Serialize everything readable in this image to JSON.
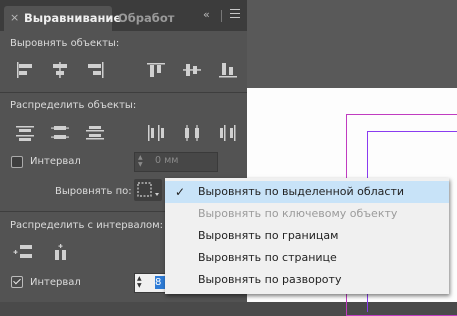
{
  "tabs": [
    {
      "label": "Выравнивание",
      "active": true
    },
    {
      "label": "Обработ",
      "active": false
    }
  ],
  "icons": {
    "tab_close": "×",
    "collapse": "‹‹"
  },
  "sections": {
    "align_objects": "Выровнять объекты:",
    "distribute_objects": "Распределить объекты:",
    "distribute_spacing": "Распределить с интервалом:"
  },
  "distribute_interval": {
    "label": "Интервал",
    "checked": false,
    "value": "0 мм"
  },
  "align_to": {
    "label": "Выровнять по:"
  },
  "spacing_interval": {
    "label": "Интервал",
    "checked": true,
    "value": "8"
  },
  "dropdown": {
    "options": [
      {
        "label": "Выровнять по выделенной области",
        "selected": true,
        "disabled": false
      },
      {
        "label": "Выровнять по ключевому объекту",
        "selected": false,
        "disabled": true
      },
      {
        "label": "Выровнять по границам",
        "selected": false,
        "disabled": false
      },
      {
        "label": "Выровнять по странице",
        "selected": false,
        "disabled": false
      },
      {
        "label": "Выровнять по развороту",
        "selected": false,
        "disabled": false
      }
    ]
  },
  "colors": {
    "panel_bg": "#535353",
    "tabbar_bg": "#3c3c3c",
    "selection_highlight": "#c8e3f8",
    "margin_guide_outer": "#c03cc0",
    "margin_guide_inner": "#8a3cf0"
  }
}
